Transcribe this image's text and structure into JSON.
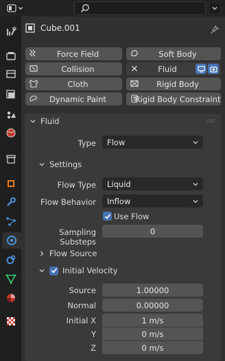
{
  "object": {
    "name": "Cube.001"
  },
  "physics_buttons": [
    {
      "label": "Force Field",
      "icon": "force-field-icon"
    },
    {
      "label": "Soft Body",
      "icon": "soft-body-icon"
    },
    {
      "label": "Collision",
      "icon": "collision-icon"
    },
    {
      "label": "Fluid",
      "icon": "close-icon"
    },
    {
      "label": "Cloth",
      "icon": "cloth-icon"
    },
    {
      "label": "Rigid Body",
      "icon": "rigid-body-icon"
    },
    {
      "label": "Dynamic Paint",
      "icon": "dynamic-paint-icon"
    },
    {
      "label": "Rigid Body Constraint",
      "icon": "rigid-body-constraint-icon"
    }
  ],
  "fluid": {
    "title": "Fluid",
    "type_label": "Type",
    "type_value": "Flow",
    "settings": {
      "title": "Settings",
      "flow_type_label": "Flow Type",
      "flow_type_value": "Liquid",
      "flow_behavior_label": "Flow Behavior",
      "flow_behavior_value": "Inflow",
      "use_flow_label": "Use Flow",
      "use_flow_checked": true,
      "sampling_label": "Sampling Substeps",
      "sampling_value": "0"
    },
    "flow_source_title": "Flow Source",
    "initial_velocity": {
      "title": "Initial Velocity",
      "checked": true,
      "source_label": "Source",
      "source_value": "1.00000",
      "normal_label": "Normal",
      "normal_value": "0.00000",
      "initial_x_label": "Initial X",
      "initial_x_value": "1 m/s",
      "y_label": "Y",
      "y_value": "0 m/s",
      "z_label": "Z",
      "z_value": "0 m/s"
    }
  },
  "colors": {
    "accent": "#4772b3",
    "panel": "#303030",
    "section": "#3a3a3a",
    "button": "#545454"
  }
}
